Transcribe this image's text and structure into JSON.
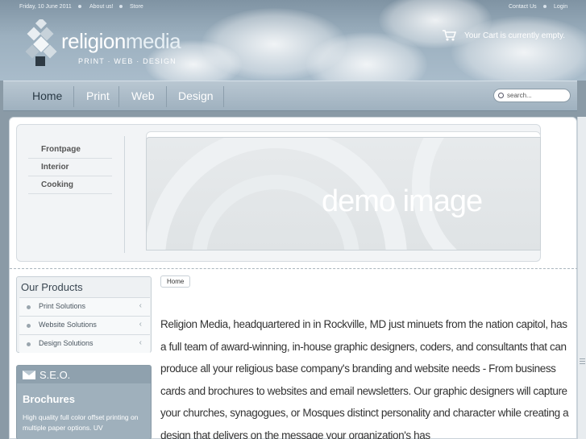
{
  "topbar": {
    "date": "Friday, 10 June 2011",
    "about": "About us!",
    "store": "Store",
    "contact": "Contact Us",
    "login": "Login"
  },
  "logo": {
    "name_a": "religion",
    "name_b": "media",
    "tagline": "PRINT · WEB · DESIGN"
  },
  "cart": {
    "icon": "cart-icon",
    "text": "Your Cart is currently empty."
  },
  "nav": {
    "items": [
      "Home",
      "Print",
      "Web",
      "Design"
    ],
    "active": "Home"
  },
  "search": {
    "placeholder": "search...",
    "icon": "search-icon"
  },
  "slider": {
    "menu": [
      "Frontpage",
      "Interior",
      "Cooking"
    ],
    "demo_text": "demo image"
  },
  "products": {
    "title": "Our Products",
    "items": [
      "Print Solutions",
      "Website Solutions",
      "Design Solutions"
    ]
  },
  "seo": {
    "title": "S.E.O.",
    "icon": "mail-icon",
    "heading": "Brochures",
    "text": "High quality full color offset printing on multiple paper options. UV"
  },
  "breadcrumb": {
    "home": "Home"
  },
  "main": {
    "paragraph": "Religion Media, headquartered in in Rockville, MD just minuets from the nation capitol, has a full team of award-winning, in-house graphic designers, coders, and consultants that can produce all your religious base company's branding and website needs - From business cards and brochures to websites and email newsletters. Our graphic designers will capture your churches, synagogues, or Mosques distinct personality and character while creating a design that delivers on the message your organization's has"
  },
  "colors": {
    "sky": "#9cb0bf",
    "nav": "#aabac7",
    "text": "#333333",
    "active_nav": "#2a3a46"
  }
}
